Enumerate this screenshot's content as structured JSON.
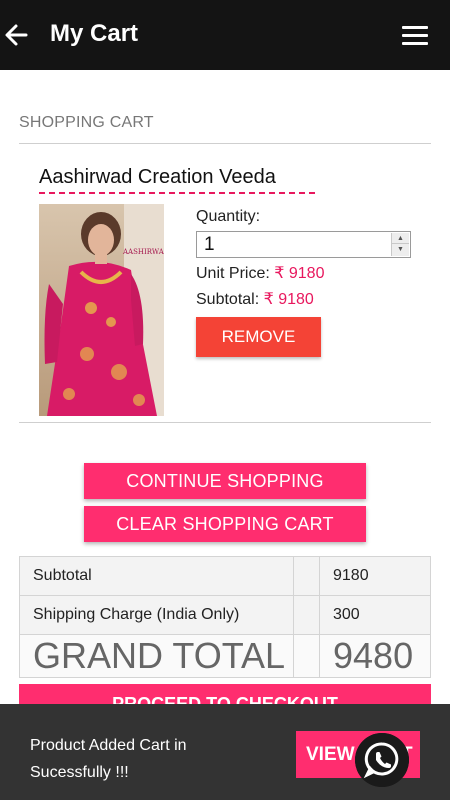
{
  "header": {
    "title": "My Cart"
  },
  "cart": {
    "section_label": "SHOPPING CART",
    "item": {
      "name": "Aashirwad Creation Veeda",
      "brand_logo": "AASHIRWAD",
      "quantity_label": "Quantity:",
      "quantity_value": "1",
      "unit_price_label": "Unit Price:",
      "unit_price": "₹ 9180",
      "subtotal_label": "Subtotal:",
      "subtotal": "₹ 9180",
      "remove_label": "REMOVE"
    },
    "continue_label": "CONTINUE SHOPPING",
    "clear_label": "CLEAR SHOPPING CART"
  },
  "totals": {
    "subtotal_label": "Subtotal",
    "subtotal_value": "9180",
    "shipping_label": "Shipping Charge (India Only)",
    "shipping_value": "300",
    "grand_total_label": "GRAND TOTAL",
    "grand_total_value": "9480"
  },
  "checkout_label": "PROCEED TO CHECKOUT",
  "snackbar": {
    "message": "Product Added Cart in Sucessfully !!!",
    "action_label": "VIEW CART"
  },
  "icons": {
    "back": "arrow-back-icon",
    "menu": "hamburger-menu-icon",
    "whatsapp": "whatsapp-icon"
  },
  "colors": {
    "appbar": "#141414",
    "accent_pink": "#ff2d6f",
    "remove_red": "#f44336",
    "price_pink": "#e8175d",
    "snackbar": "#333333"
  }
}
